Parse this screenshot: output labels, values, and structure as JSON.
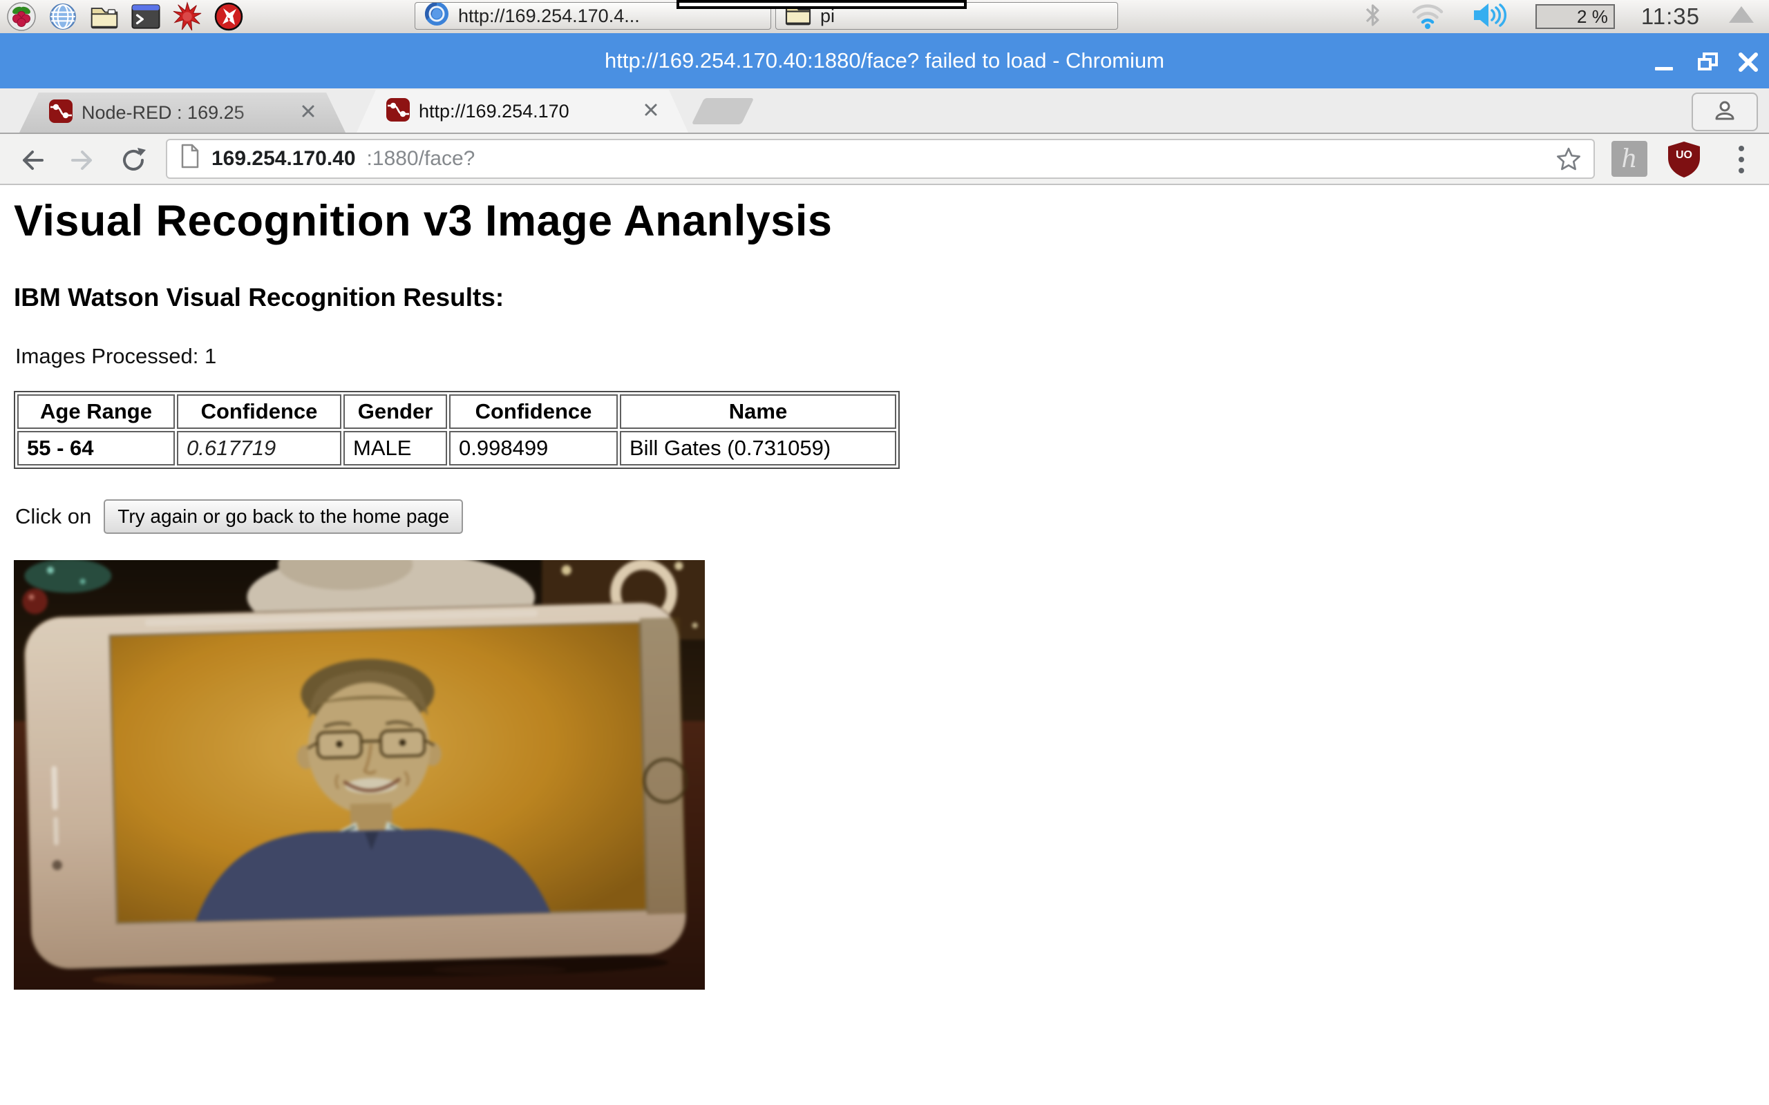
{
  "taskbar": {
    "window_buttons": [
      {
        "label": "http://169.254.170.4..."
      },
      {
        "label": "pi"
      }
    ],
    "battery": "2 %",
    "clock": "11:35"
  },
  "browser": {
    "window_title": "http://169.254.170.40:1880/face? failed to load - Chromium",
    "tabs": [
      {
        "label": "Node-RED : 169.25"
      },
      {
        "label": "http://169.254.170"
      }
    ],
    "url_host": "169.254.170.40",
    "url_rest": ":1880/face?",
    "extension_h_label": "h",
    "ublock_label": "UO"
  },
  "page": {
    "heading": "Visual Recognition v3 Image Ananlysis",
    "subheading": "IBM Watson Visual Recognition Results:",
    "images_processed": "Images Processed: 1",
    "table": {
      "headers": [
        "Age Range",
        "Confidence",
        "Gender",
        "Confidence",
        "Name"
      ],
      "row": [
        "55 - 64",
        "0.617719",
        "MALE",
        "0.998499",
        "Bill Gates (0.731059)"
      ]
    },
    "click_on": "Click on",
    "try_again_button": "Try again or go back to the home page"
  },
  "colors": {
    "titlebar_blue": "#4a90e2",
    "node_red_red": "#8e1313",
    "ublock_red": "#7e1012",
    "tray_blue": "#2aa8f0"
  }
}
